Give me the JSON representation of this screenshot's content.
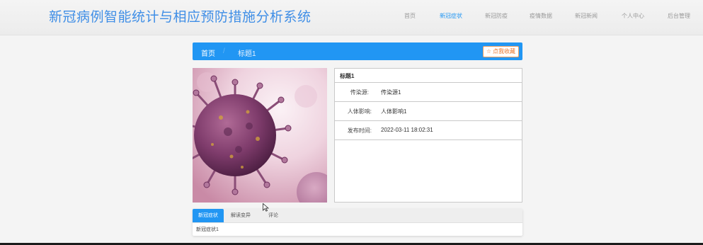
{
  "header": {
    "title": "新冠病例智能统计与相应预防措施分析系统",
    "nav": [
      {
        "label": "首页",
        "active": false
      },
      {
        "label": "新冠症状",
        "active": true
      },
      {
        "label": "新冠防疫",
        "active": false
      },
      {
        "label": "疫情数据",
        "active": false
      },
      {
        "label": "新冠新闻",
        "active": false
      },
      {
        "label": "个人中心",
        "active": false
      },
      {
        "label": "后台管理",
        "active": false
      }
    ]
  },
  "breadcrumb": {
    "home": "首页",
    "separator": "/",
    "current": "标题1"
  },
  "favorite_button": {
    "icon": "star-icon",
    "label": "点我收藏"
  },
  "image": {
    "subject": "virus-illustration"
  },
  "detail": {
    "title": "标题1",
    "rows": [
      {
        "label": "传染源:",
        "value": "传染源1"
      },
      {
        "label": "人体影响:",
        "value": "人体影响1"
      },
      {
        "label": "发布时间:",
        "value": "2022-03-11 18:02:31"
      }
    ]
  },
  "tabs": {
    "items": [
      {
        "label": "新冠症状",
        "active": true
      },
      {
        "label": "解读变异",
        "active": false
      },
      {
        "label": "评论",
        "active": false
      }
    ],
    "content": "新冠症状1"
  },
  "colors": {
    "accent": "#2196f3",
    "title": "#3f8ee6",
    "favorite": "#e8762c"
  }
}
